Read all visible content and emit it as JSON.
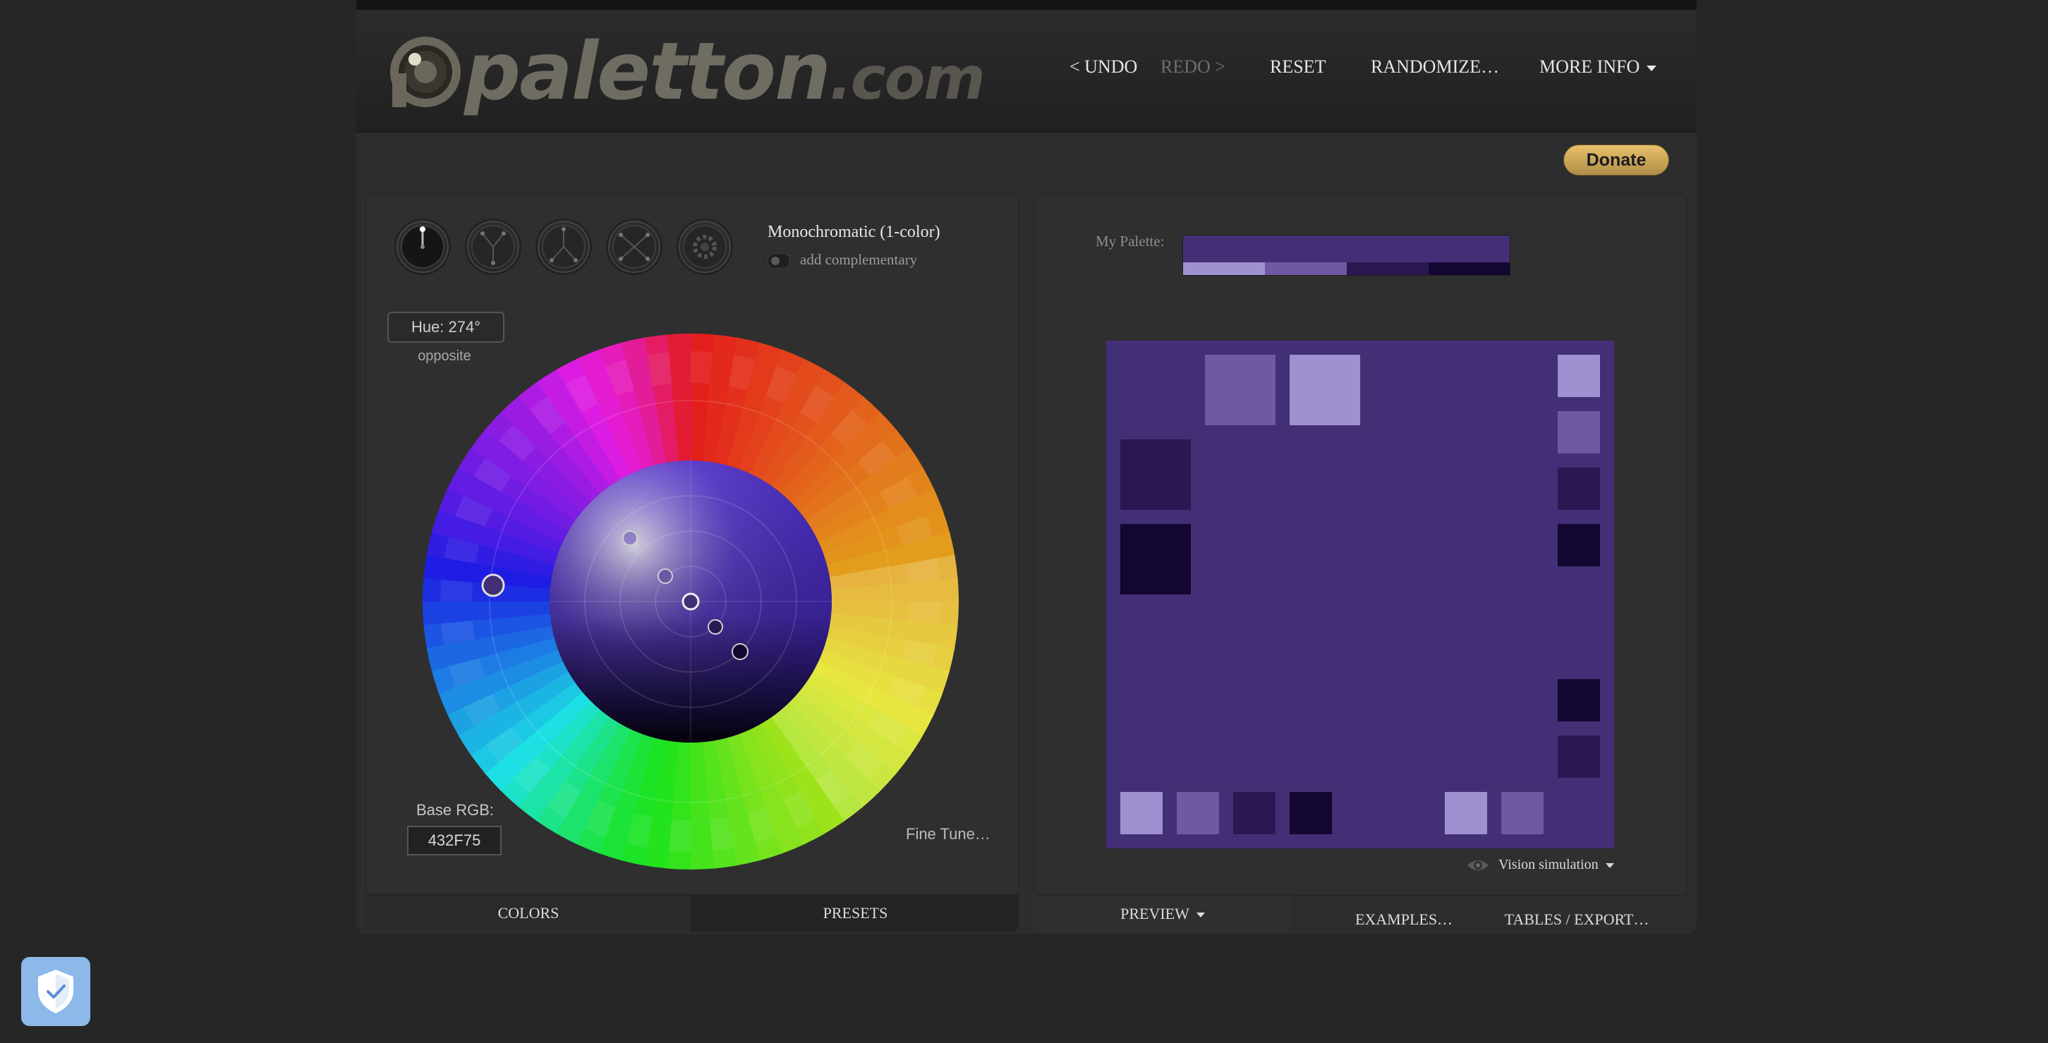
{
  "header": {
    "logo_text": "paletton",
    "logo_suffix": ".com",
    "nav": {
      "undo": "< UNDO",
      "redo": "REDO >",
      "reset": "RESET",
      "randomize": "RANDOMIZE…",
      "more_info": "MORE INFO"
    }
  },
  "donate_label": "Donate",
  "scheme": {
    "title": "Monochromatic (1-color)",
    "add_complementary": "add complementary",
    "buttons": [
      "mono-scheme-icon",
      "adjacent-scheme-icon",
      "triad-scheme-icon",
      "tetrad-scheme-icon",
      "free-style-scheme-icon"
    ],
    "selected_index": 0
  },
  "hue": {
    "label": "Hue: 274°",
    "opposite": "opposite"
  },
  "base": {
    "label": "Base RGB:",
    "value": "432F75"
  },
  "fine_tune": "Fine Tune…",
  "left_tabs": {
    "colors": "COLORS",
    "presets": "PRESETS"
  },
  "right_tabs": {
    "preview": "PREVIEW",
    "examples": "EXAMPLES…",
    "tables": "TABLES / EXPORT…"
  },
  "my_palette": {
    "label": "My Palette:",
    "base": "#432F75",
    "swatches": [
      "#9F91CF",
      "#6D5AA3",
      "#2A1853",
      "#130631"
    ]
  },
  "vision_simulation": "Vision simulation",
  "colors": {
    "base": "#432F75",
    "lightest": "#9F91CF",
    "light": "#6D5AA3",
    "dark": "#2A1853",
    "darkest": "#130631"
  }
}
